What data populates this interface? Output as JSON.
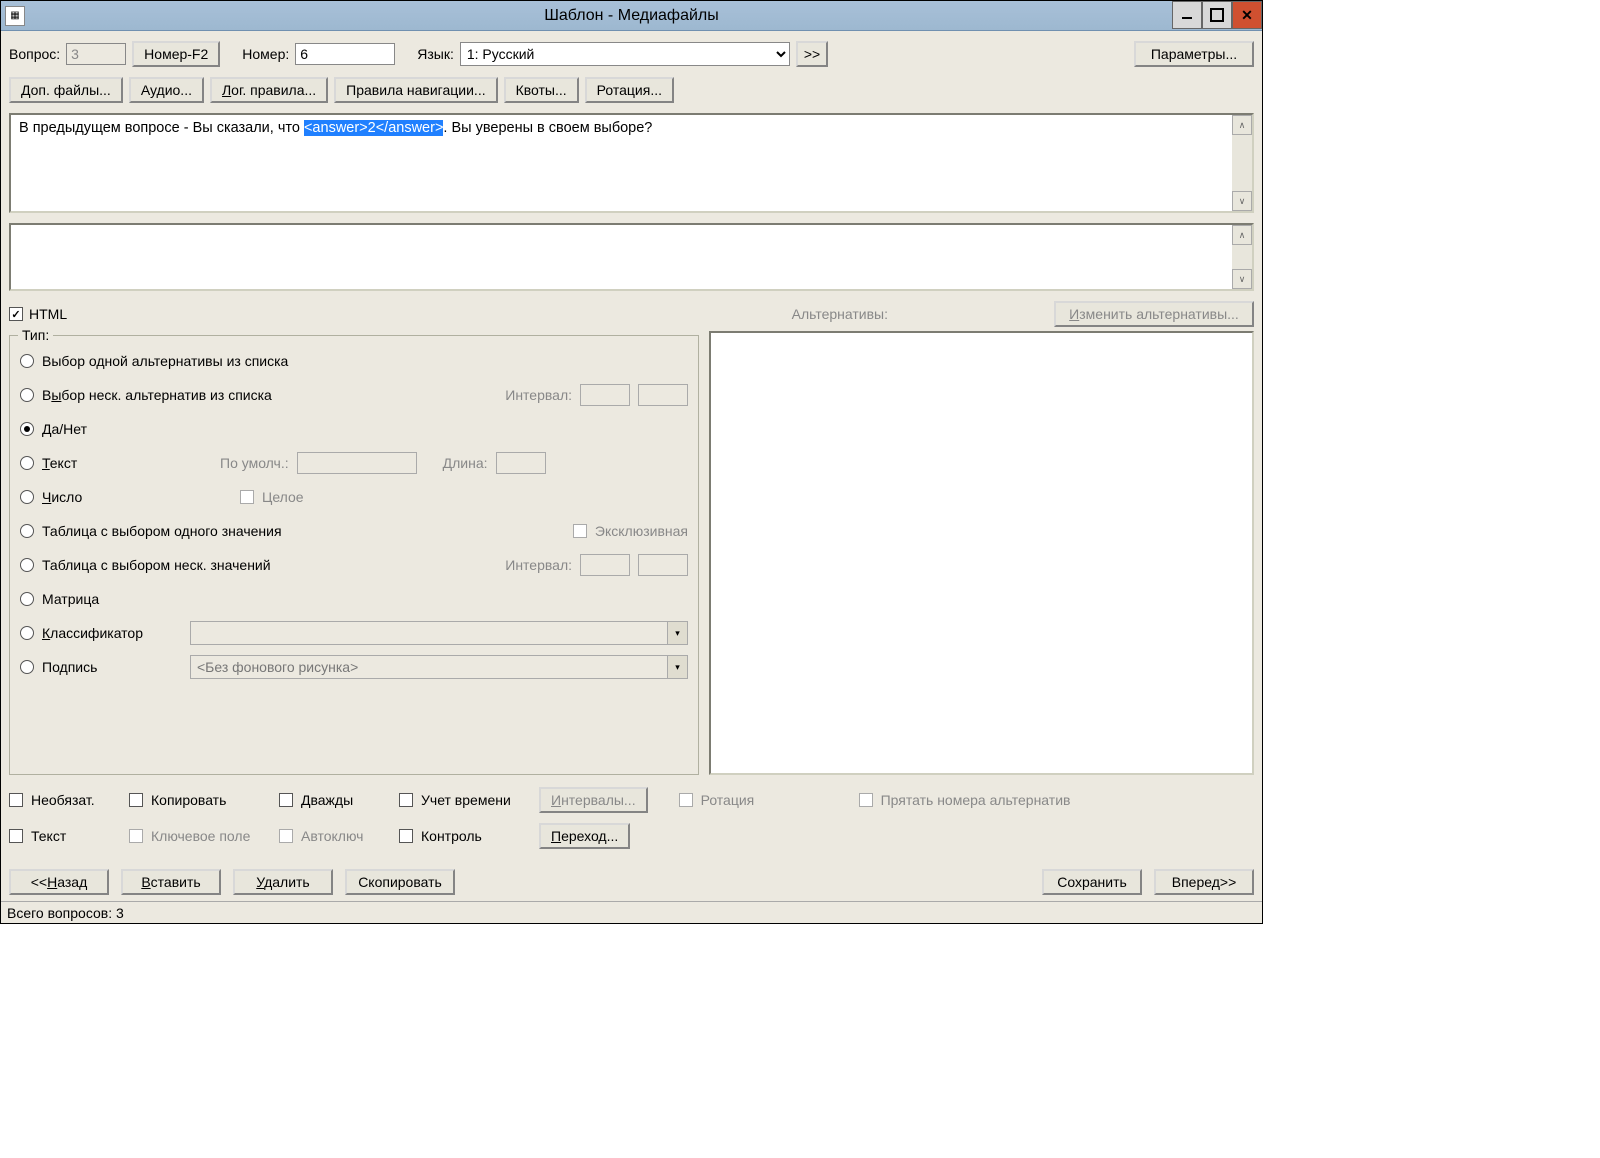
{
  "titlebar": {
    "title": "Шаблон - Медиафайлы"
  },
  "top_row": {
    "question_label": "Вопрос:",
    "question_value": "3",
    "number_f2_btn": "Номер-F2",
    "number_label": "Номер:",
    "number_value": "6",
    "language_label": "Язык:",
    "language_value": "1: Русский",
    "params_btn": "Параметры..."
  },
  "buttons_row": {
    "additional_files": "Доп. файлы...",
    "audio": "Аудио...",
    "logic_rules": "Лог. правила...",
    "nav_rules": "Правила навигации...",
    "quotas": "Квоты...",
    "rotation": "Ротация..."
  },
  "question_text": {
    "before": "В предыдущем вопросе - Вы сказали, что ",
    "highlighted": "<answer>2</answer>",
    "after": ". Вы уверены в своем выборе?"
  },
  "html_checkbox_label": "HTML",
  "alternatives_label": "Альтернативы:",
  "change_alternatives_btn": "Изменить альтернативы...",
  "type_group": {
    "legend": "Тип:",
    "single_choice": "Выбор одной альтернативы из списка",
    "multi_choice": "Выбор неск. альтернатив из списка",
    "interval_label": "Интервал:",
    "yesno": "Да/Нет",
    "text": "Текст",
    "default_label": "По умолч.:",
    "length_label": "Длина:",
    "number": "Число",
    "integer_label": "Целое",
    "table_single": "Таблица с выбором одного значения",
    "exclusive_label": "Эксклюзивная",
    "table_multi": "Таблица с выбором неск. значений",
    "interval_label2": "Интервал:",
    "matrix": "Матрица",
    "classifier": "Классификатор",
    "caption": "Подпись",
    "no_bg_image": "<Без фонового рисунка>"
  },
  "bottom_checks": {
    "optional": "Необязат.",
    "copy": "Копировать",
    "twice": "Дважды",
    "time_tracking": "Учет времени",
    "intervals_btn": "Интервалы...",
    "rotation": "Ротация",
    "hide_alt_numbers": "Прятать номера альтернатив",
    "text": "Текст",
    "key_field": "Ключевое поле",
    "autokey": "Автоключ",
    "control": "Контроль",
    "goto_btn": "Переход..."
  },
  "nav_buttons": {
    "back": "<<Назад",
    "insert": "Вставить",
    "delete": "Удалить",
    "copy": "Скопировать",
    "save": "Сохранить",
    "forward": "Вперед>>"
  },
  "statusbar": {
    "total_questions": "Всего вопросов: 3"
  }
}
